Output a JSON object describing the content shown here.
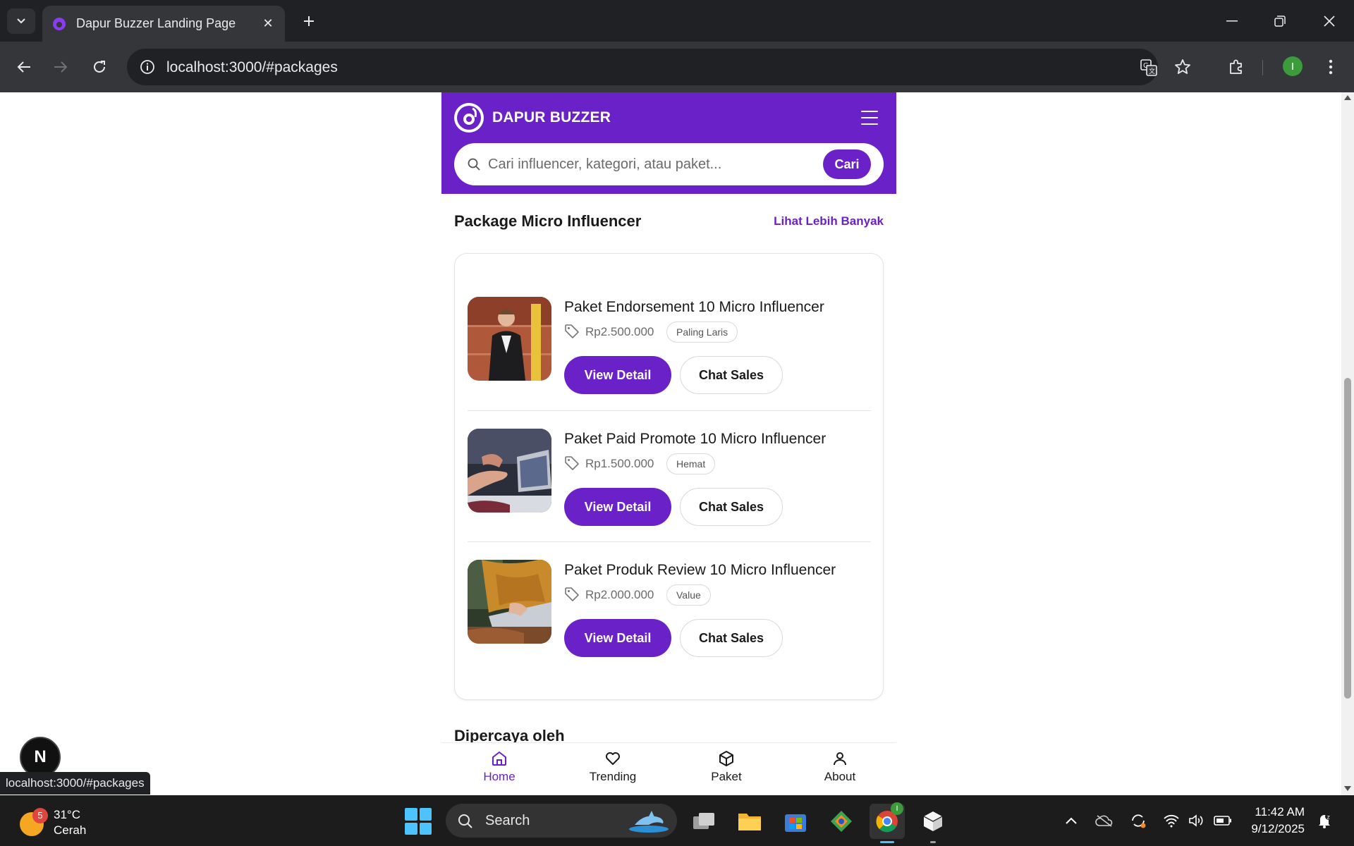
{
  "browser": {
    "tab_title": "Dapur Buzzer Landing Page",
    "url": "localhost:3000/#packages",
    "status_url": "localhost:3000/#packages",
    "profile_initial": "I"
  },
  "header": {
    "brand": "DAPUR BUZZER",
    "search_placeholder": "Cari influencer, kategori, atau paket...",
    "search_button": "Cari"
  },
  "section": {
    "title": "Package Micro Influencer",
    "more_link": "Lihat Lebih Banyak"
  },
  "packages": [
    {
      "title": "Paket Endorsement 10 Micro Influencer",
      "price": "Rp2.500.000",
      "badge": "Paling Laris",
      "detail_label": "View Detail",
      "chat_label": "Chat Sales"
    },
    {
      "title": "Paket Paid Promote 10 Micro Influencer",
      "price": "Rp1.500.000",
      "badge": "Hemat",
      "detail_label": "View Detail",
      "chat_label": "Chat Sales"
    },
    {
      "title": "Paket Produk Review 10 Micro Influencer",
      "price": "Rp2.000.000",
      "badge": "Value",
      "detail_label": "View Detail",
      "chat_label": "Chat Sales"
    }
  ],
  "trusted_heading": "Dipercaya oleh",
  "bottom_nav": [
    {
      "label": "Home",
      "icon": "home-icon",
      "active": true
    },
    {
      "label": "Trending",
      "icon": "heart-icon",
      "active": false
    },
    {
      "label": "Paket",
      "icon": "box-icon",
      "active": false
    },
    {
      "label": "About",
      "icon": "user-icon",
      "active": false
    }
  ],
  "next_badge": "N",
  "taskbar": {
    "weather_temp": "31°C",
    "weather_desc": "Cerah",
    "weather_badge": "5",
    "search_label": "Search",
    "time": "11:42 AM",
    "date": "9/12/2025",
    "chrome_badge": "I"
  },
  "colors": {
    "brand": "#6b21c8",
    "chrome_dark": "#202124",
    "chrome_toolbar": "#35363a"
  }
}
